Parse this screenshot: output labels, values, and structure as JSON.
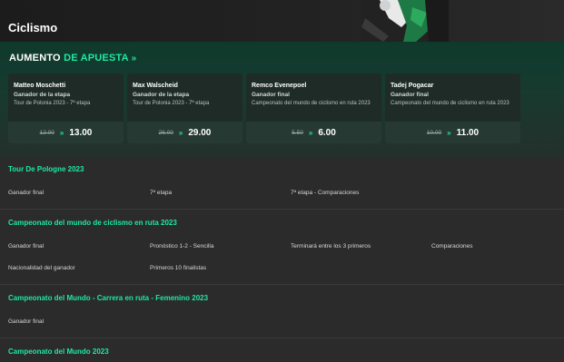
{
  "header": {
    "title": "Ciclismo"
  },
  "boost": {
    "title_white": "AUMENTO",
    "title_green": "DE APUESTA",
    "cards": [
      {
        "name": "Matteo Moschetti",
        "market": "Ganador de la etapa",
        "event": "Tour de Polonia 2023 - 7ª etapa",
        "old_odds": "12.00",
        "new_odds": "13.00"
      },
      {
        "name": "Max Walscheid",
        "market": "Ganador de la etapa",
        "event": "Tour de Polonia 2023 - 7ª etapa",
        "old_odds": "26.00",
        "new_odds": "29.00"
      },
      {
        "name": "Remco Evenepoel",
        "market": "Ganador final",
        "event": "Campeonato del mundo de ciclismo en ruta 2023",
        "old_odds": "5.50",
        "new_odds": "6.00"
      },
      {
        "name": "Tadej Pogacar",
        "market": "Ganador final",
        "event": "Campeonato del mundo de ciclismo en ruta 2023",
        "old_odds": "10.00",
        "new_odds": "11.00"
      }
    ]
  },
  "sections": [
    {
      "title": "Tour De Pologne 2023",
      "links": [
        "Ganador final",
        "7ª etapa",
        "7ª etapa - Comparaciones"
      ]
    },
    {
      "title": "Campeonato del mundo de ciclismo en ruta 2023",
      "links": [
        "Ganador final",
        "Pronóstico 1-2 - Sencilla",
        "Terminará entre los 3 primeros",
        "Comparaciones",
        "Nacionalidad del ganador",
        "Primeros 10 finalistas"
      ]
    },
    {
      "title": "Campeonato del Mundo - Carrera en ruta - Femenino 2023",
      "links": [
        "Ganador final"
      ]
    },
    {
      "title": "Campeonato del Mundo 2023",
      "links": []
    }
  ],
  "icons": {
    "boost_arrow": "double-chevron-right-icon",
    "odds_arrow": "double-chevron-right-icon"
  },
  "colors": {
    "accent": "#1de9a1",
    "background": "#2b2b2b",
    "card": "#1e2b26"
  }
}
